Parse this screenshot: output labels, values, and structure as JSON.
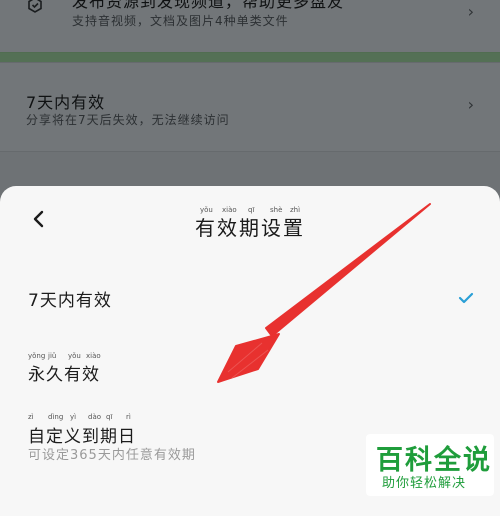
{
  "background": {
    "item1": {
      "title": "发布资源到发现频道，帮助更多盘友",
      "subtitle": "支持音视频，文档及图片4种单类文件"
    },
    "item2": {
      "title": "7天内有效",
      "subtitle": "分享将在7天后失效，无法继续访问"
    },
    "chevron": "›"
  },
  "sheet": {
    "title": "有效期设置",
    "title_pinyin": [
      "yǒu",
      "xiào",
      "qī",
      "shè",
      "zhì"
    ],
    "back_icon": "chevron-left-icon",
    "options": [
      {
        "label": "7天内有效",
        "subtitle": "",
        "selected": true
      },
      {
        "label": "永久有效",
        "pinyin": [
          "yǒng",
          "jiǔ",
          "yǒu",
          "xiào"
        ],
        "subtitle": "",
        "selected": false
      },
      {
        "label": "自定义到期日",
        "pinyin": [
          "zì",
          "dìng",
          "yì",
          "dào",
          "qī",
          "rì"
        ],
        "subtitle": "可设定365天内任意有效期",
        "selected": false
      }
    ],
    "check_color": "#2a9fd6"
  },
  "annotation": {
    "arrow_color": "#e8312f"
  },
  "watermark": {
    "line1": "百科全说",
    "line2": "助你轻松解决",
    "color": "#1f9d3b"
  }
}
